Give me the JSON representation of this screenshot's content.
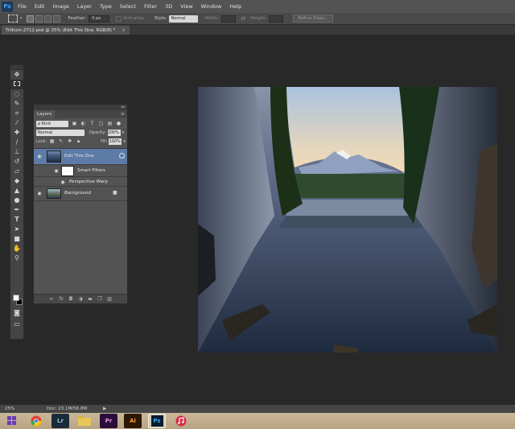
{
  "app": {
    "logo": "Ps"
  },
  "menu": [
    "File",
    "Edit",
    "Image",
    "Layer",
    "Type",
    "Select",
    "Filter",
    "3D",
    "View",
    "Window",
    "Help"
  ],
  "options_bar": {
    "feather_label": "Feather:",
    "feather_value": "0 px",
    "anti_alias_label": "Anti-alias",
    "style_label": "Style:",
    "style_value": "Normal",
    "width_label": "Width:",
    "height_label": "Height:",
    "refine_edge_label": "Refine Edge..."
  },
  "document_tab": {
    "title": "Trillium-2712.psd @ 25% (Edit This One, RGB/8) *",
    "close": "×"
  },
  "layers_panel": {
    "collapse_glyph": "◂◂",
    "tab_label": "Layers",
    "menu_glyph": "≡",
    "filter_kind": "ρ Kind",
    "blend_mode": "Normal",
    "opacity_label": "Opacity:",
    "opacity_value": "100%",
    "lock_label": "Lock:",
    "fill_label": "Fill:",
    "fill_value": "100%",
    "layers": [
      {
        "name": "Edit This One",
        "selected": true
      },
      {
        "name": "Smart Filters"
      },
      {
        "name": "Perspective Warp"
      },
      {
        "name": "Background",
        "locked": true
      }
    ]
  },
  "status_bar": {
    "zoom": "25%",
    "doc_size": "Doc: 23.1M/56.8M",
    "arrow": "▶"
  },
  "taskbar": {
    "apps": [
      {
        "name": "start",
        "icon": "windows-logo",
        "color": "#6b3bb5"
      },
      {
        "name": "chrome",
        "icon": "chrome-icon",
        "color": "#e0443a"
      },
      {
        "name": "lightroom",
        "label": "Lr",
        "color": "#1b2a38",
        "text_color": "#9ac3e5"
      },
      {
        "name": "explorer",
        "icon": "folder-icon",
        "color": "#e8c65a"
      },
      {
        "name": "premiere",
        "label": "Pr",
        "color": "#2a0e3a",
        "text_color": "#d89be8"
      },
      {
        "name": "illustrator",
        "label": "Ai",
        "color": "#2c1605",
        "text_color": "#ff9a2a"
      },
      {
        "name": "photoshop",
        "label": "Ps",
        "color": "#061b2f",
        "text_color": "#3fa8f5",
        "active": true
      },
      {
        "name": "itunes",
        "icon": "itunes-icon",
        "color": "#d82b4b"
      }
    ]
  }
}
